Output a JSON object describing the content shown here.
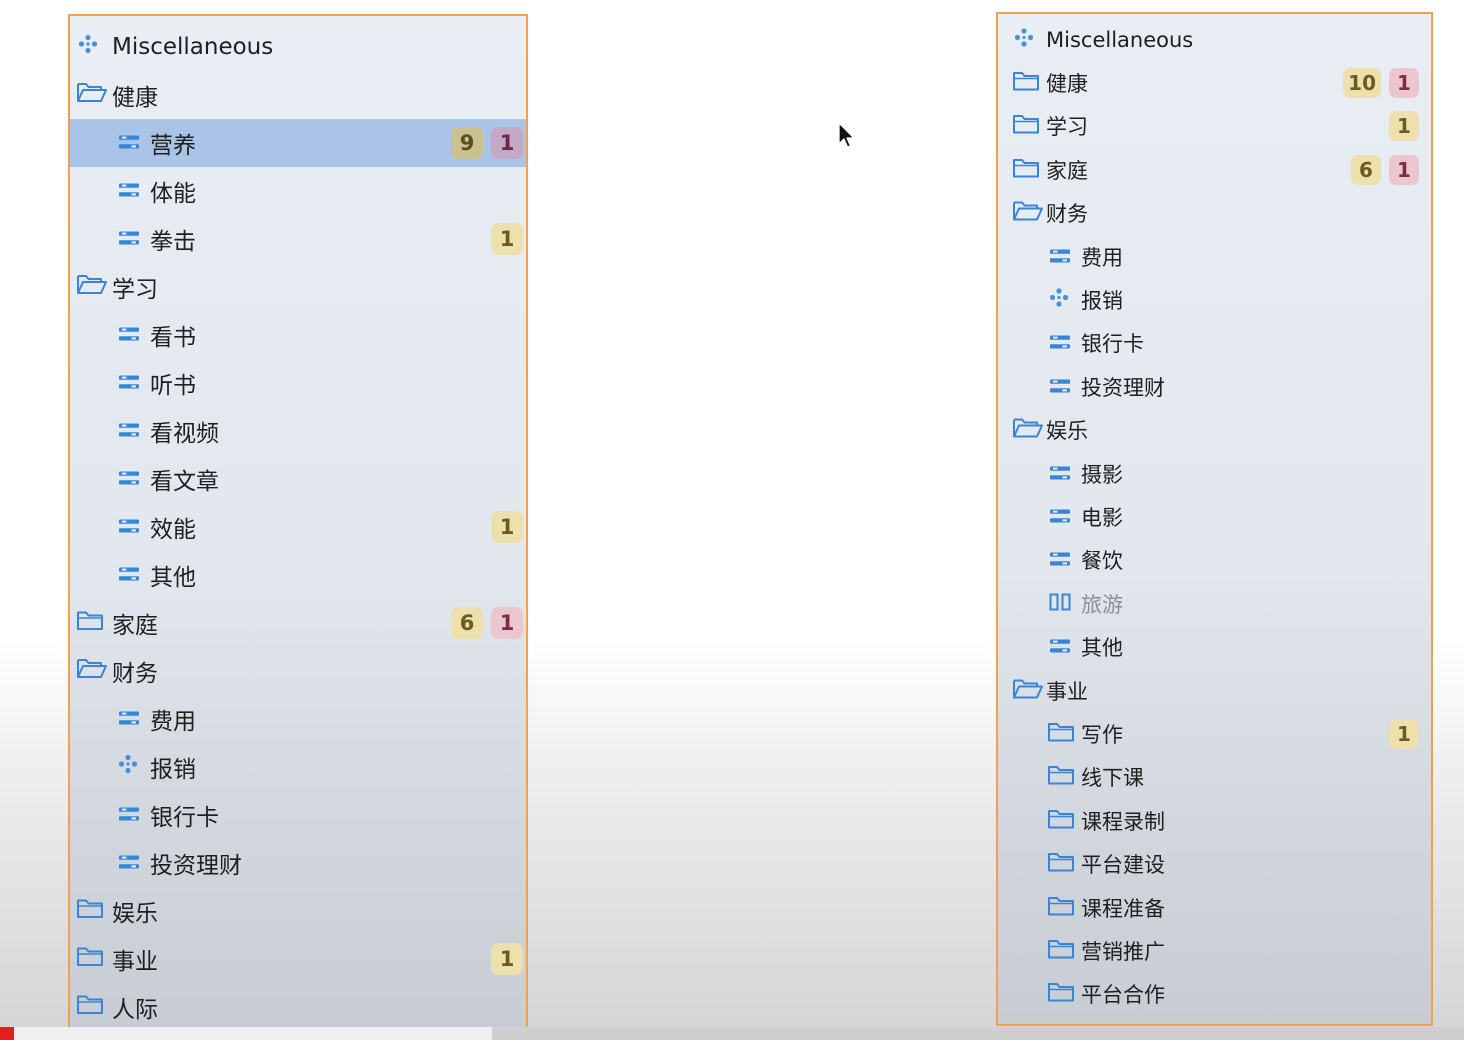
{
  "left_panel": {
    "rows": [
      {
        "label": "Miscellaneous",
        "icon": "sparkle-icon",
        "level": 0
      },
      {
        "label": "健康",
        "icon": "folder-open-icon",
        "level": 0
      },
      {
        "label": "营养",
        "icon": "list-icon",
        "level": 1,
        "selected": true,
        "badges": [
          "9",
          "1"
        ]
      },
      {
        "label": "体能",
        "icon": "list-icon",
        "level": 1
      },
      {
        "label": "拳击",
        "icon": "list-icon",
        "level": 1,
        "badges": [
          "1"
        ]
      },
      {
        "label": "学习",
        "icon": "folder-open-icon",
        "level": 0
      },
      {
        "label": "看书",
        "icon": "list-icon",
        "level": 1
      },
      {
        "label": "听书",
        "icon": "list-icon",
        "level": 1
      },
      {
        "label": "看视频",
        "icon": "list-icon",
        "level": 1
      },
      {
        "label": "看文章",
        "icon": "list-icon",
        "level": 1
      },
      {
        "label": "效能",
        "icon": "list-icon",
        "level": 1,
        "badges": [
          "1"
        ]
      },
      {
        "label": "其他",
        "icon": "list-icon",
        "level": 1
      },
      {
        "label": "家庭",
        "icon": "folder-icon",
        "level": 0,
        "badges": [
          "6",
          "1"
        ]
      },
      {
        "label": "财务",
        "icon": "folder-open-icon",
        "level": 0
      },
      {
        "label": "费用",
        "icon": "list-icon",
        "level": 1
      },
      {
        "label": "报销",
        "icon": "sparkle-icon",
        "level": 1
      },
      {
        "label": "银行卡",
        "icon": "list-icon",
        "level": 1
      },
      {
        "label": "投资理财",
        "icon": "list-icon",
        "level": 1
      },
      {
        "label": "娱乐",
        "icon": "folder-icon",
        "level": 0
      },
      {
        "label": "事业",
        "icon": "folder-icon",
        "level": 0,
        "badges": [
          "1"
        ]
      },
      {
        "label": "人际",
        "icon": "folder-icon",
        "level": 0
      }
    ]
  },
  "right_panel": {
    "rows": [
      {
        "label": "Miscellaneous",
        "icon": "sparkle-icon",
        "level": 0
      },
      {
        "label": "健康",
        "icon": "folder-icon",
        "level": 0,
        "badges": [
          "10",
          "1"
        ]
      },
      {
        "label": "学习",
        "icon": "folder-icon",
        "level": 0,
        "badges": [
          "1"
        ]
      },
      {
        "label": "家庭",
        "icon": "folder-icon",
        "level": 0,
        "badges": [
          "6",
          "1"
        ]
      },
      {
        "label": "财务",
        "icon": "folder-open-icon",
        "level": 0
      },
      {
        "label": "费用",
        "icon": "list-icon",
        "level": 1
      },
      {
        "label": "报销",
        "icon": "sparkle-icon",
        "level": 1
      },
      {
        "label": "银行卡",
        "icon": "list-icon",
        "level": 1
      },
      {
        "label": "投资理财",
        "icon": "list-icon",
        "level": 1
      },
      {
        "label": "娱乐",
        "icon": "folder-open-icon",
        "level": 0
      },
      {
        "label": "摄影",
        "icon": "list-icon",
        "level": 1
      },
      {
        "label": "电影",
        "icon": "list-icon",
        "level": 1
      },
      {
        "label": "餐饮",
        "icon": "list-icon",
        "level": 1
      },
      {
        "label": "旅游",
        "icon": "columns-icon",
        "level": 1,
        "dimmed": true
      },
      {
        "label": "其他",
        "icon": "list-icon",
        "level": 1
      },
      {
        "label": "事业",
        "icon": "folder-open-icon",
        "level": 0
      },
      {
        "label": "写作",
        "icon": "folder-icon",
        "level": 1,
        "badges": [
          "1"
        ]
      },
      {
        "label": "线下课",
        "icon": "folder-icon",
        "level": 1
      },
      {
        "label": "课程录制",
        "icon": "folder-icon",
        "level": 1
      },
      {
        "label": "平台建设",
        "icon": "folder-icon",
        "level": 1
      },
      {
        "label": "课程准备",
        "icon": "folder-icon",
        "level": 1
      },
      {
        "label": "营销推广",
        "icon": "folder-icon",
        "level": 1
      },
      {
        "label": "平台合作",
        "icon": "folder-icon",
        "level": 1
      }
    ]
  },
  "colors": {
    "panel_border": "#f0a24a",
    "selection": "#a9c4e6",
    "icon_blue": "#3a84d6",
    "badge_yellow": "#ece0ad",
    "badge_pink": "#ecc6cf"
  },
  "video_progress": 0.01
}
